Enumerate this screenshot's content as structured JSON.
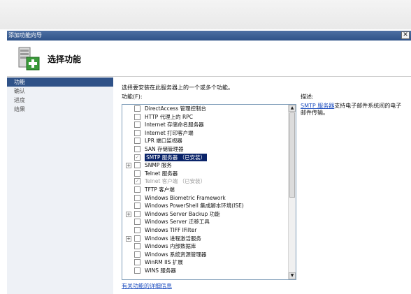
{
  "window": {
    "title": "添加功能向导",
    "close_glyph": "✕"
  },
  "header": {
    "title": "选择功能"
  },
  "steps": [
    {
      "label": "功能",
      "active": true
    },
    {
      "label": "确认",
      "active": false
    },
    {
      "label": "进度",
      "active": false
    },
    {
      "label": "结果",
      "active": false
    }
  ],
  "main": {
    "instruction": "选择要安装在此服务器上的一个或多个功能。",
    "features_label": "功能(F):",
    "more_info_link": "有关功能的详细信息"
  },
  "features": [
    {
      "label": "DirectAccess 管理控制台",
      "checked": false,
      "expandable": false,
      "installed": false,
      "selected": false
    },
    {
      "label": "HTTP 代理上的 RPC",
      "checked": false,
      "expandable": false,
      "installed": false,
      "selected": false
    },
    {
      "label": "Internet 存储命名服务器",
      "checked": false,
      "expandable": false,
      "installed": false,
      "selected": false
    },
    {
      "label": "Internet 打印客户端",
      "checked": false,
      "expandable": false,
      "installed": false,
      "selected": false
    },
    {
      "label": "LPR 端口监视器",
      "checked": false,
      "expandable": false,
      "installed": false,
      "selected": false
    },
    {
      "label": "SAN 存储管理器",
      "checked": false,
      "expandable": false,
      "installed": false,
      "selected": false
    },
    {
      "label": "SMTP 服务器 （已安装）",
      "checked": true,
      "expandable": false,
      "installed": true,
      "selected": true
    },
    {
      "label": "SNMP 服务",
      "checked": false,
      "expandable": true,
      "installed": false,
      "selected": false
    },
    {
      "label": "Telnet 服务器",
      "checked": false,
      "expandable": false,
      "installed": false,
      "selected": false
    },
    {
      "label": "Telnet 客户端 （已安装）",
      "checked": true,
      "expandable": false,
      "installed": true,
      "selected": false
    },
    {
      "label": "TFTP 客户端",
      "checked": false,
      "expandable": false,
      "installed": false,
      "selected": false
    },
    {
      "label": "Windows Biometric Framework",
      "checked": false,
      "expandable": false,
      "installed": false,
      "selected": false
    },
    {
      "label": "Windows PowerShell 集成脚本环境(ISE)",
      "checked": false,
      "expandable": false,
      "installed": false,
      "selected": false
    },
    {
      "label": "Windows Server Backup 功能",
      "checked": false,
      "expandable": true,
      "installed": false,
      "selected": false
    },
    {
      "label": "Windows Server 迁移工具",
      "checked": false,
      "expandable": false,
      "installed": false,
      "selected": false
    },
    {
      "label": "Windows TIFF IFilter",
      "checked": false,
      "expandable": false,
      "installed": false,
      "selected": false
    },
    {
      "label": "Windows 进程激活服务",
      "checked": false,
      "expandable": true,
      "installed": false,
      "selected": false
    },
    {
      "label": "Windows 内部数据库",
      "checked": false,
      "expandable": false,
      "installed": false,
      "selected": false
    },
    {
      "label": "Windows 系统资源管理器",
      "checked": false,
      "expandable": false,
      "installed": false,
      "selected": false
    },
    {
      "label": "WinRM IIS 扩展",
      "checked": false,
      "expandable": false,
      "installed": false,
      "selected": false
    },
    {
      "label": "WINS 服务器",
      "checked": false,
      "expandable": false,
      "installed": false,
      "selected": false
    }
  ],
  "description": {
    "title": "描述:",
    "link": "SMTP 服务器",
    "text": "支持电子邮件系统间的电子邮件传输。"
  },
  "scrollbar": {
    "up_glyph": "▲",
    "down_glyph": "▼"
  },
  "icons": {
    "expand_glyph": "+",
    "check_glyph": "✓"
  },
  "colors": {
    "titlebar": "#2f5288",
    "active_step": "#2f5288",
    "selection": "#0a246a",
    "link": "#1f4fbf"
  }
}
